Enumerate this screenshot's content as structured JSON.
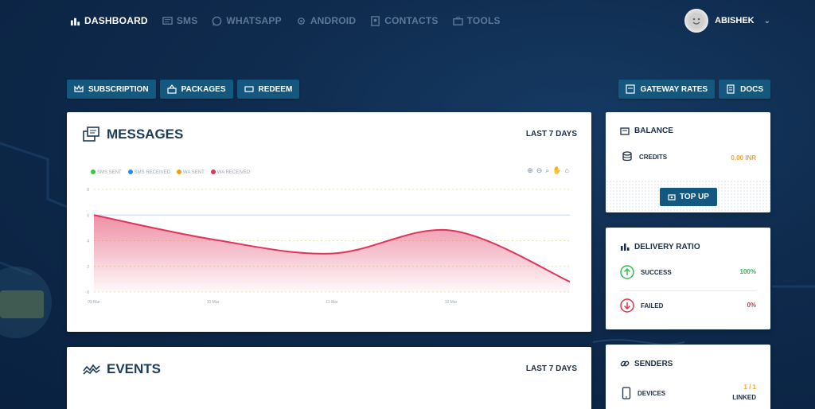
{
  "nav": {
    "items": [
      {
        "label": "DASHBOARD",
        "icon": "bar-chart-icon",
        "active": true
      },
      {
        "label": "SMS",
        "icon": "sms-icon",
        "active": false
      },
      {
        "label": "WHATSAPP",
        "icon": "whatsapp-icon",
        "active": false
      },
      {
        "label": "ANDROID",
        "icon": "android-icon",
        "active": false
      },
      {
        "label": "CONTACTS",
        "icon": "contacts-icon",
        "active": false
      },
      {
        "label": "TOOLS",
        "icon": "tools-icon",
        "active": false
      }
    ],
    "user": {
      "name": "ABISHEK"
    }
  },
  "actions_left": [
    {
      "label": "SUBSCRIPTION",
      "icon": "crown-icon"
    },
    {
      "label": "PACKAGES",
      "icon": "packages-icon"
    },
    {
      "label": "REDEEM",
      "icon": "ticket-icon"
    }
  ],
  "actions_right": [
    {
      "label": "GATEWAY RATES",
      "icon": "rates-icon"
    },
    {
      "label": "DOCS",
      "icon": "docs-icon"
    }
  ],
  "messages": {
    "title": "MESSAGES",
    "range": "LAST 7 DAYS"
  },
  "events": {
    "title": "EVENTS",
    "range": "LAST 7 DAYS"
  },
  "balance": {
    "title": "BALANCE",
    "credits_label": "CREDITS",
    "credits_value": "0.00 INR",
    "topup_label": "TOP UP"
  },
  "delivery": {
    "title": "DELIVERY RATIO",
    "success_label": "SUCCESS",
    "success_value": "100%",
    "failed_label": "FAILED",
    "failed_value": "0%"
  },
  "senders": {
    "title": "SENDERS",
    "devices_label": "DEVICES",
    "devices_value": "1 / 1",
    "devices_status": "LINKED"
  },
  "colors": {
    "accent": "#15587f",
    "success": "#2ebd4e",
    "failed": "#e0344c",
    "credits": "#f0a43a",
    "series_sms_sent": "#2ecc40",
    "series_sms_received": "#1e90ff",
    "series_wa_sent": "#f39c12",
    "series_wa_received": "#e0345c"
  },
  "chart_data": {
    "type": "area",
    "x": [
      "09 Mar",
      "10 Mar",
      "11 Mar",
      "12 Mar"
    ],
    "x_values": [
      9,
      10,
      11,
      12,
      13
    ],
    "ylim": [
      0,
      8
    ],
    "yticks": [
      "0",
      "2",
      "4",
      "6",
      "8"
    ],
    "grid": true,
    "legend_position": "top-left",
    "series": [
      {
        "name": "SMS SENT",
        "values": []
      },
      {
        "name": "SMS RECEIVED",
        "values": []
      },
      {
        "name": "WA SENT",
        "values": []
      },
      {
        "name": "WA RECEIVED",
        "values": [
          6.0,
          4.1,
          3.0,
          4.8,
          0.8
        ]
      }
    ]
  }
}
